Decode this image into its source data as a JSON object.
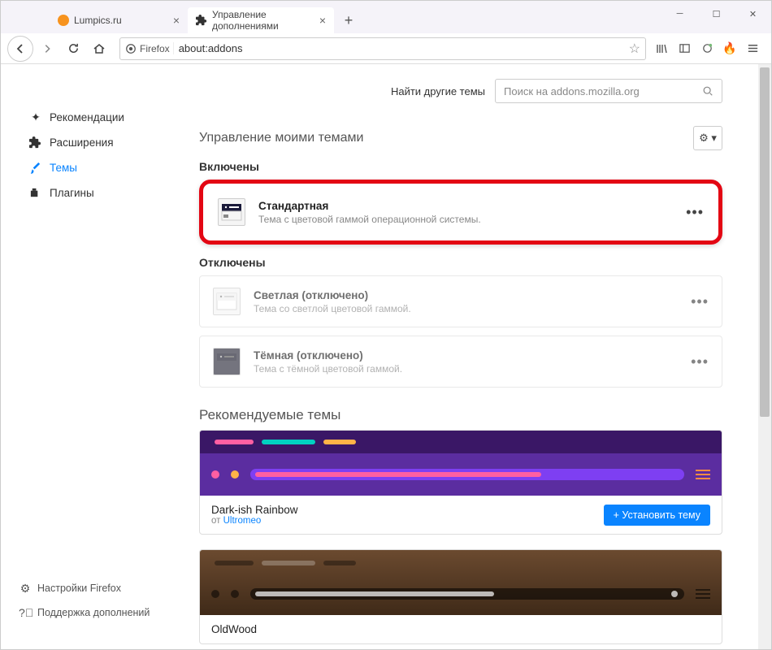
{
  "tabs": [
    {
      "label": "Lumpics.ru"
    },
    {
      "label": "Управление дополнениями"
    }
  ],
  "url": {
    "identity": "Firefox",
    "address": "about:addons"
  },
  "sidebar": {
    "items": [
      {
        "label": "Рекомендации"
      },
      {
        "label": "Расширения"
      },
      {
        "label": "Темы"
      },
      {
        "label": "Плагины"
      }
    ],
    "bottom": [
      {
        "label": "Настройки Firefox"
      },
      {
        "label": "Поддержка дополнений"
      }
    ]
  },
  "find": {
    "label": "Найти другие темы",
    "placeholder": "Поиск на addons.mozilla.org"
  },
  "page": {
    "title": "Управление моими темами"
  },
  "sections": {
    "enabled": "Включены",
    "disabled": "Отключены",
    "recommended": "Рекомендуемые темы"
  },
  "themes": {
    "enabled": [
      {
        "name": "Стандартная",
        "desc": "Тема с цветовой гаммой операционной системы."
      }
    ],
    "disabled": [
      {
        "name": "Светлая (отключено)",
        "desc": "Тема со светлой цветовой гаммой."
      },
      {
        "name": "Тёмная (отключено)",
        "desc": "Тема с тёмной цветовой гаммой."
      }
    ]
  },
  "recommended": [
    {
      "name": "Dark-ish Rainbow",
      "author_prefix": "от ",
      "author": "Ultromeo",
      "install": "+ Установить тему"
    },
    {
      "name": "OldWood",
      "author_prefix": "",
      "author": "",
      "install": ""
    }
  ]
}
